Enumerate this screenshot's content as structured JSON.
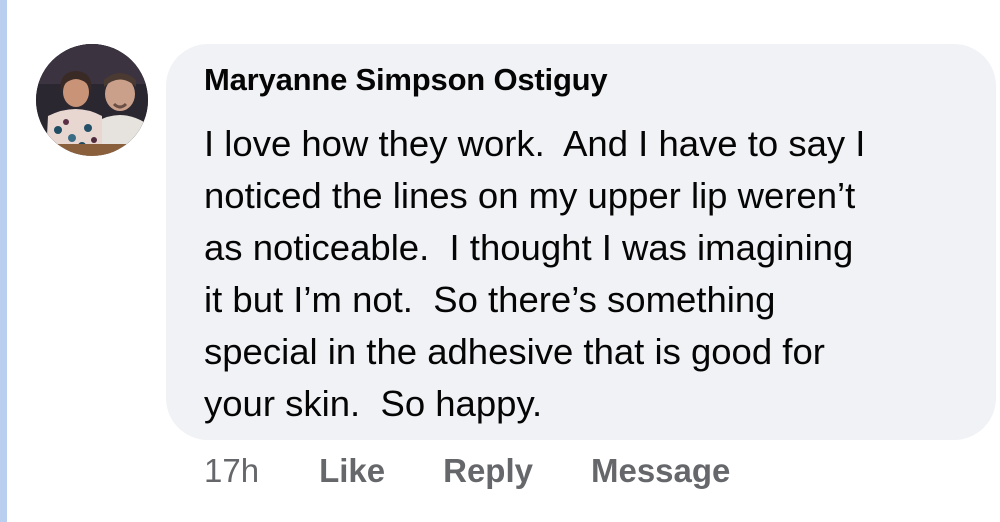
{
  "comment": {
    "author": "Maryanne Simpson Ostiguy",
    "body": "I love how they work.  And I have to say I\nnoticed the lines on my upper lip weren’t\nas noticeable.  I thought I was imagining\nit but I’m not.  So there’s something\nspecial in the adhesive that is good for\nyour skin.  So happy."
  },
  "actions": {
    "timestamp": "17h",
    "like_label": "Like",
    "reply_label": "Reply",
    "message_label": "Message"
  },
  "colors": {
    "bubble_background": "#f0f2f5",
    "text_primary": "#050505",
    "text_secondary": "#65676b",
    "thread_line": "#b9cff0"
  },
  "icons": {
    "avatar": "profile-photo-avatar"
  }
}
